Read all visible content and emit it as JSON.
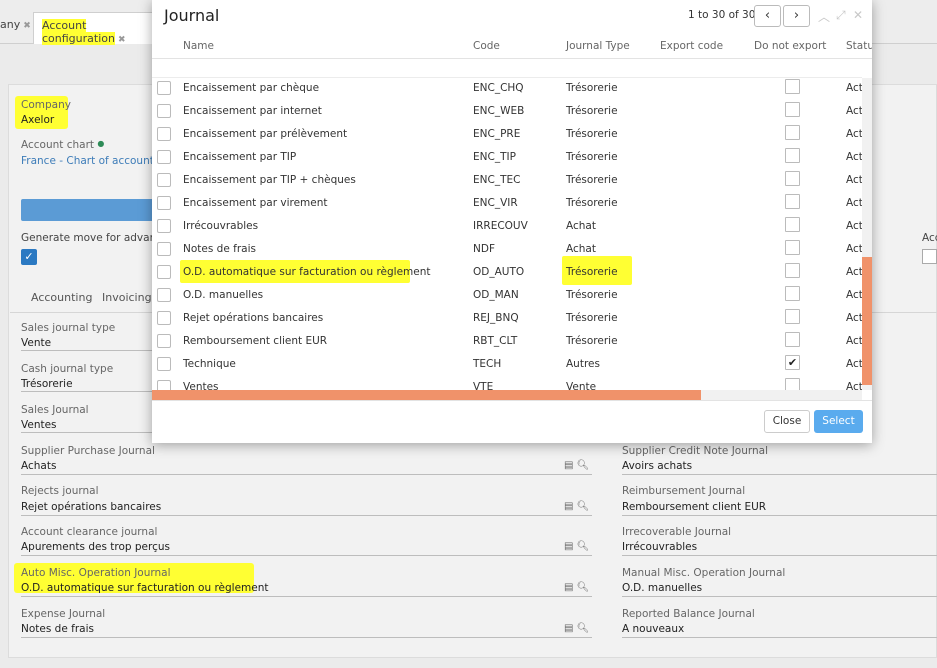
{
  "tabs": [
    {
      "label": "any"
    },
    {
      "label": "Account configuration"
    }
  ],
  "form": {
    "company_label": "Company",
    "company_value": "Axelor",
    "account_chart_label": "Account chart",
    "account_chart_value": "France - Chart of accounts",
    "generate_move_label": "Generate move for advance",
    "right_cut_label": "Acc",
    "subtabs": [
      "Accounting",
      "Invoicing"
    ],
    "left_fields": [
      {
        "label": "Sales journal type",
        "value": "Vente"
      },
      {
        "label": "Cash journal type",
        "value": "Trésorerie"
      },
      {
        "label": "Sales Journal",
        "value": "Ventes"
      },
      {
        "label": "Supplier Purchase Journal",
        "value": "Achats"
      },
      {
        "label": "Rejects journal",
        "value": "Rejet opérations bancaires"
      },
      {
        "label": "Account clearance journal",
        "value": "Apurements des trop perçus"
      },
      {
        "label": "Auto Misc. Operation Journal",
        "value": "O.D. automatique sur facturation ou règlement"
      },
      {
        "label": "Expense Journal",
        "value": "Notes de frais"
      }
    ],
    "right_fields": [
      {
        "label": "Supplier Credit Note Journal",
        "value": "Avoirs achats"
      },
      {
        "label": "Reimbursement Journal",
        "value": "Remboursement client EUR"
      },
      {
        "label": "Irrecoverable Journal",
        "value": "Irrécouvrables"
      },
      {
        "label": "Manual Misc. Operation Journal",
        "value": "O.D. manuelles"
      },
      {
        "label": "Reported Balance Journal",
        "value": "A nouveaux"
      }
    ]
  },
  "modal": {
    "title": "Journal",
    "pager_text": "1 to 30 of 30",
    "columns": [
      "Name",
      "Code",
      "Journal Type",
      "Export code",
      "Do not export",
      "Status"
    ],
    "rows": [
      {
        "name": "Encaissement par chèque",
        "code": "ENC_CHQ",
        "type": "Trésorerie",
        "noexport": "",
        "status": "Acti"
      },
      {
        "name": "Encaissement par internet",
        "code": "ENC_WEB",
        "type": "Trésorerie",
        "noexport": "",
        "status": "Acti"
      },
      {
        "name": "Encaissement par prélèvement",
        "code": "ENC_PRE",
        "type": "Trésorerie",
        "noexport": "",
        "status": "Acti"
      },
      {
        "name": "Encaissement par TIP",
        "code": "ENC_TIP",
        "type": "Trésorerie",
        "noexport": "",
        "status": "Acti"
      },
      {
        "name": "Encaissement par TIP + chèques",
        "code": "ENC_TEC",
        "type": "Trésorerie",
        "noexport": "",
        "status": "Acti"
      },
      {
        "name": "Encaissement par virement",
        "code": "ENC_VIR",
        "type": "Trésorerie",
        "noexport": "",
        "status": "Acti"
      },
      {
        "name": "Irrécouvrables",
        "code": "IRRECOUV",
        "type": "Achat",
        "noexport": "",
        "status": "Acti"
      },
      {
        "name": "Notes de frais",
        "code": "NDF",
        "type": "Achat",
        "noexport": "",
        "status": "Acti"
      },
      {
        "name": "O.D. automatique sur facturation ou règlement",
        "code": "OD_AUTO",
        "type": "Trésorerie",
        "noexport": "",
        "status": "Acti"
      },
      {
        "name": "O.D. manuelles",
        "code": "OD_MAN",
        "type": "Trésorerie",
        "noexport": "",
        "status": "Acti"
      },
      {
        "name": "Rejet opérations bancaires",
        "code": "REJ_BNQ",
        "type": "Trésorerie",
        "noexport": "",
        "status": "Acti"
      },
      {
        "name": "Remboursement client EUR",
        "code": "RBT_CLT",
        "type": "Trésorerie",
        "noexport": "",
        "status": "Acti"
      },
      {
        "name": "Technique",
        "code": "TECH",
        "type": "Autres",
        "noexport": "✔",
        "status": "Acti"
      },
      {
        "name": "Ventes",
        "code": "VTE",
        "type": "Vente",
        "noexport": "",
        "status": "Acti"
      }
    ],
    "close_label": "Close",
    "select_label": "Select"
  },
  "colors": {
    "highlight": "#ffff33",
    "primary_button": "#5aabee",
    "scrollbar_thumb": "#f0926a",
    "link": "#3d7cb8"
  },
  "icons": {
    "prev": "chevron-left-icon",
    "next": "chevron-right-icon",
    "collapse": "chevron-up-icon",
    "expand": "expand-icon",
    "close": "close-icon",
    "view": "document-icon",
    "search": "search-icon",
    "info": "info-icon",
    "check": "check-icon"
  }
}
